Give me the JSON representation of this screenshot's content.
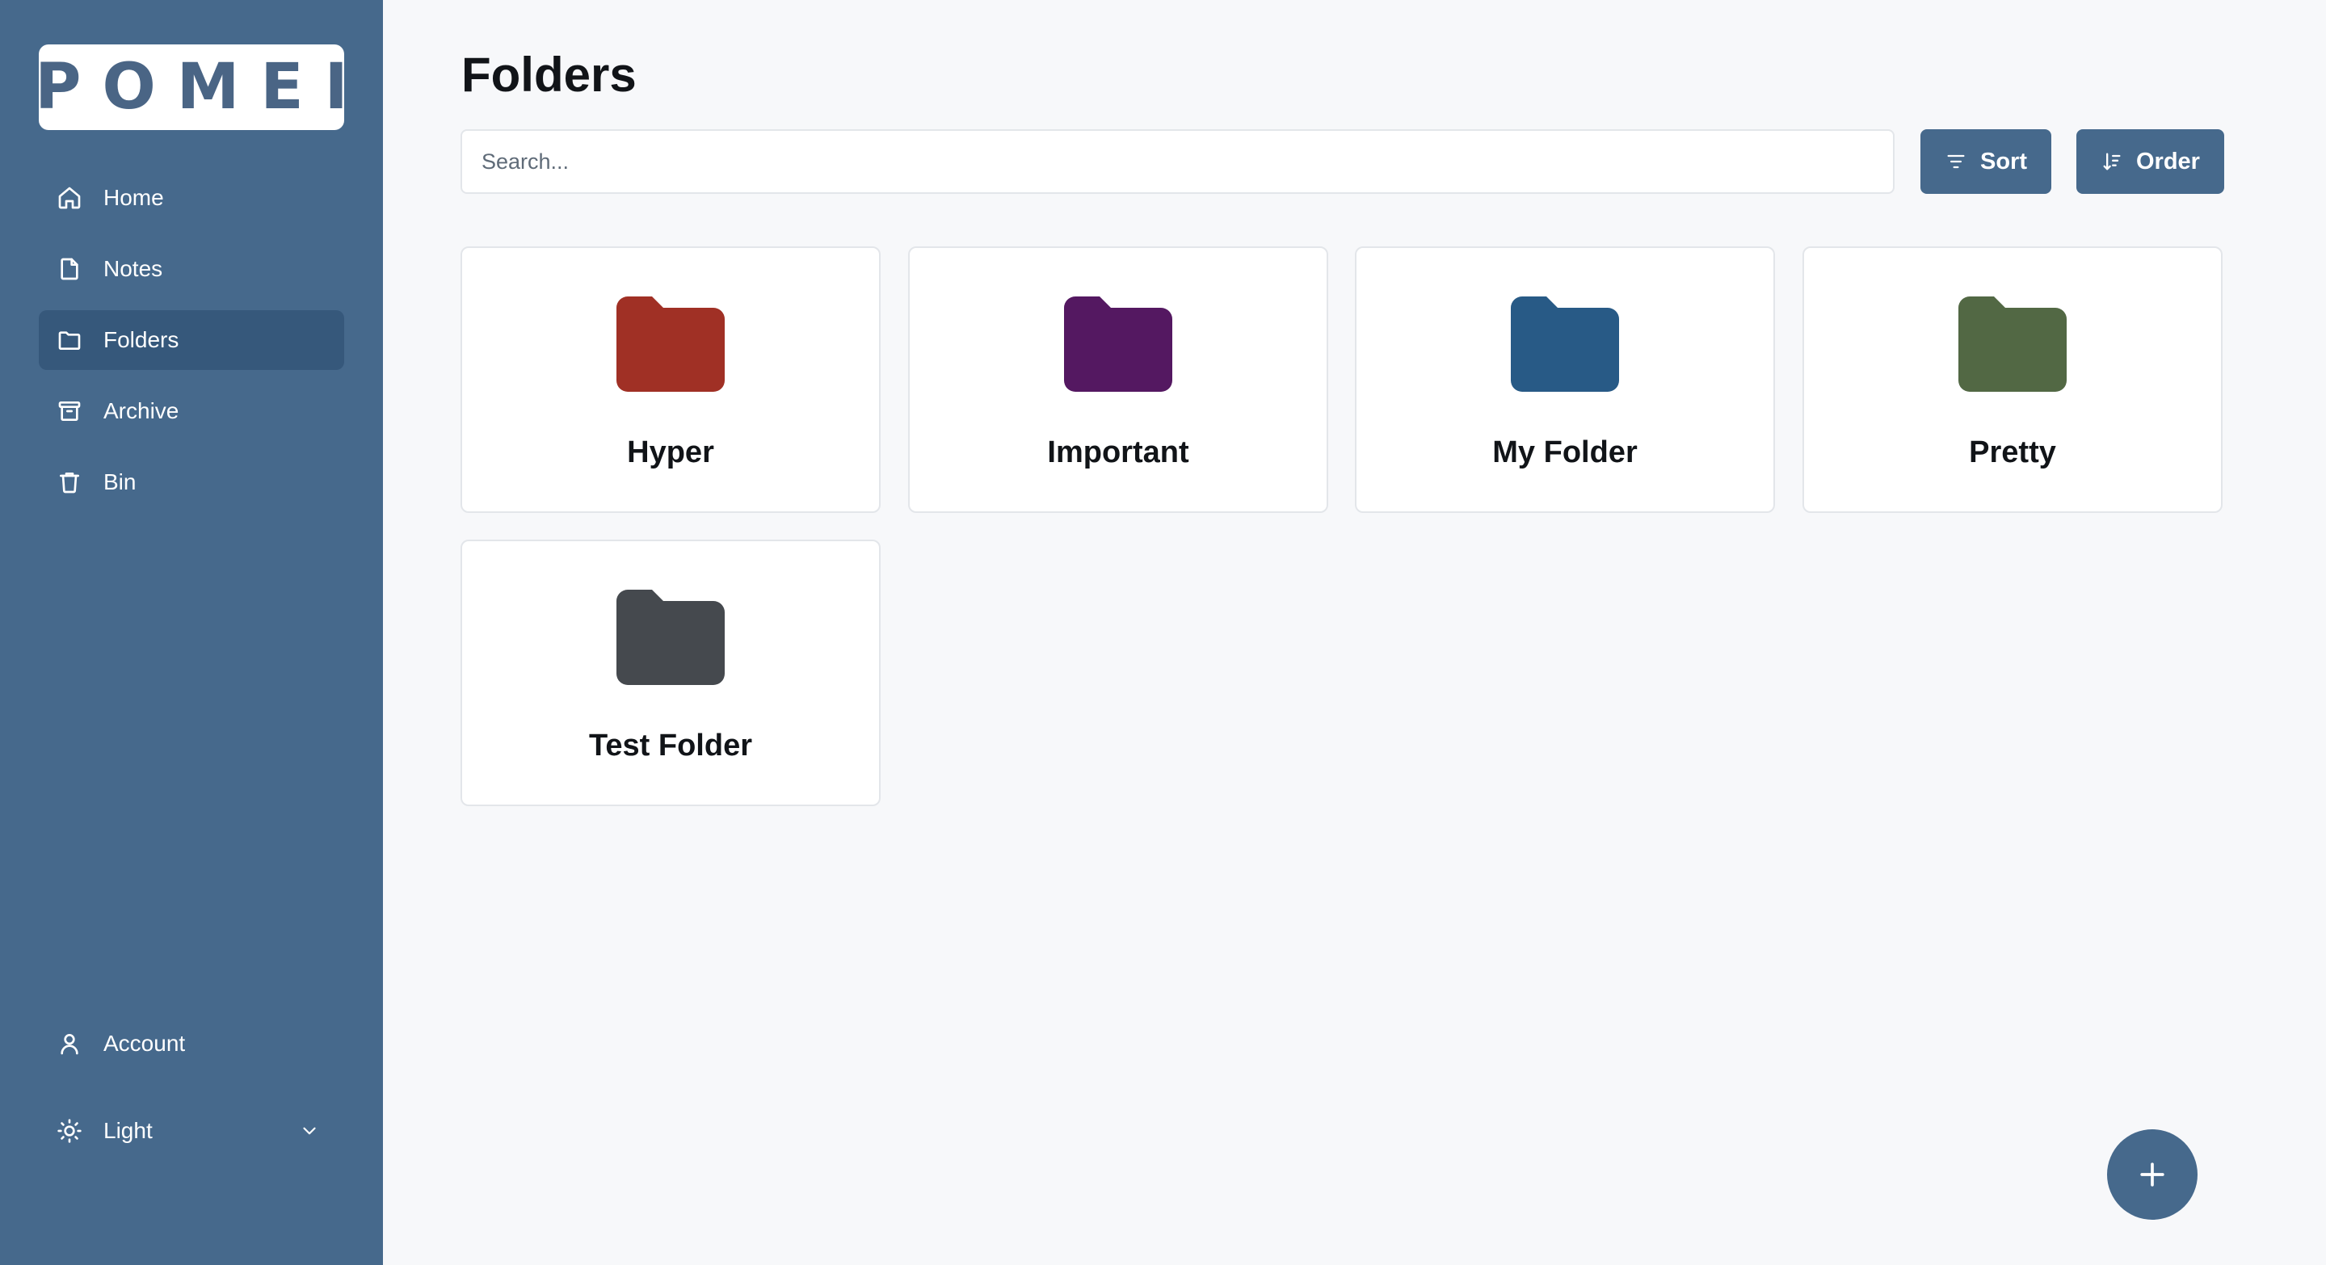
{
  "logo": {
    "text": "POMEI"
  },
  "sidebar": {
    "items": [
      {
        "label": "Home",
        "icon": "home-icon"
      },
      {
        "label": "Notes",
        "icon": "note-icon"
      },
      {
        "label": "Folders",
        "icon": "folder-icon",
        "active": true
      },
      {
        "label": "Archive",
        "icon": "archive-icon"
      },
      {
        "label": "Bin",
        "icon": "trash-icon"
      }
    ],
    "account": {
      "label": "Account",
      "icon": "user-icon"
    },
    "theme": {
      "label": "Light",
      "icon": "sun-icon"
    }
  },
  "main": {
    "title": "Folders",
    "search": {
      "placeholder": "Search...",
      "value": ""
    },
    "sort_label": "Sort",
    "order_label": "Order",
    "folders": [
      {
        "name": "Hyper",
        "color": "#a03025"
      },
      {
        "name": "Important",
        "color": "#541861"
      },
      {
        "name": "My Folder",
        "color": "#285a86"
      },
      {
        "name": "Pretty",
        "color": "#526844"
      },
      {
        "name": "Test Folder",
        "color": "#45494e"
      }
    ]
  },
  "colors": {
    "sidebar": "#46698c",
    "sidebar_active": "#36587b",
    "accent": "#46698c",
    "background": "#f7f8fa"
  }
}
